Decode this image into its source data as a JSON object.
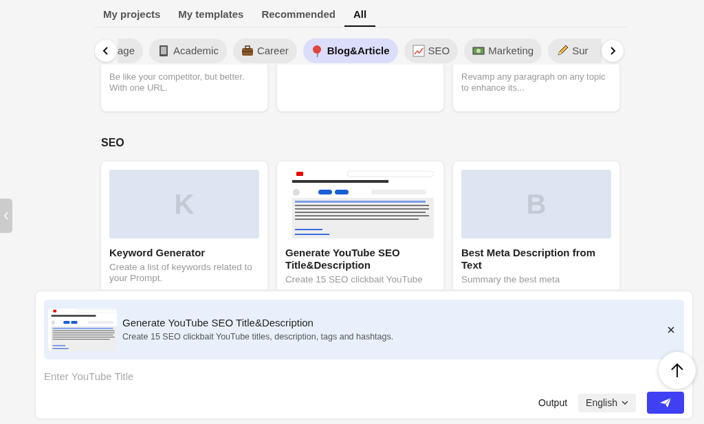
{
  "tabs": [
    {
      "label": "My projects",
      "selected": false
    },
    {
      "label": "My templates",
      "selected": false
    },
    {
      "label": "Recommended",
      "selected": false
    },
    {
      "label": "All",
      "selected": true
    }
  ],
  "categories": [
    {
      "label": "age",
      "kind": "none",
      "selected": false
    },
    {
      "label": "Academic",
      "kind": "book",
      "selected": false
    },
    {
      "label": "Career",
      "kind": "briefcase",
      "selected": false
    },
    {
      "label": "Blog&Article",
      "kind": "balloon",
      "selected": true
    },
    {
      "label": "SEO",
      "kind": "chart",
      "selected": false
    },
    {
      "label": "Marketing",
      "kind": "banknote",
      "selected": false
    },
    {
      "label": "Sur",
      "kind": "pencil",
      "selected": false
    }
  ],
  "top_cards": [
    {
      "kind": "text",
      "description": "Be like your competitor, but better. With one URL."
    },
    {
      "kind": "blank"
    },
    {
      "kind": "text",
      "description": "Revamp any paragraph on any topic to enhance its..."
    }
  ],
  "sections": [
    {
      "title": "SEO",
      "cards": [
        {
          "kind": "letter",
          "letter": "K",
          "title": "Keyword Generator",
          "description": "Create a list of keywords related to your Prompt."
        },
        {
          "kind": "picture",
          "title": "Generate YouTube SEO Title&Description",
          "description": "Create 15 SEO clickbait YouTube"
        },
        {
          "kind": "letter",
          "letter": "B",
          "title": "Best Meta Description from Text",
          "description": "Summary the best meta"
        }
      ]
    }
  ],
  "selected_tool": {
    "kind": "picture",
    "title": "Generate YouTube SEO Title&Description",
    "description": "Create 15 SEO clickbait YouTube titles, description, tags and hashtags."
  },
  "input": {
    "placeholder": "Enter YouTube Title"
  },
  "output_label": "Output",
  "language": "English"
}
